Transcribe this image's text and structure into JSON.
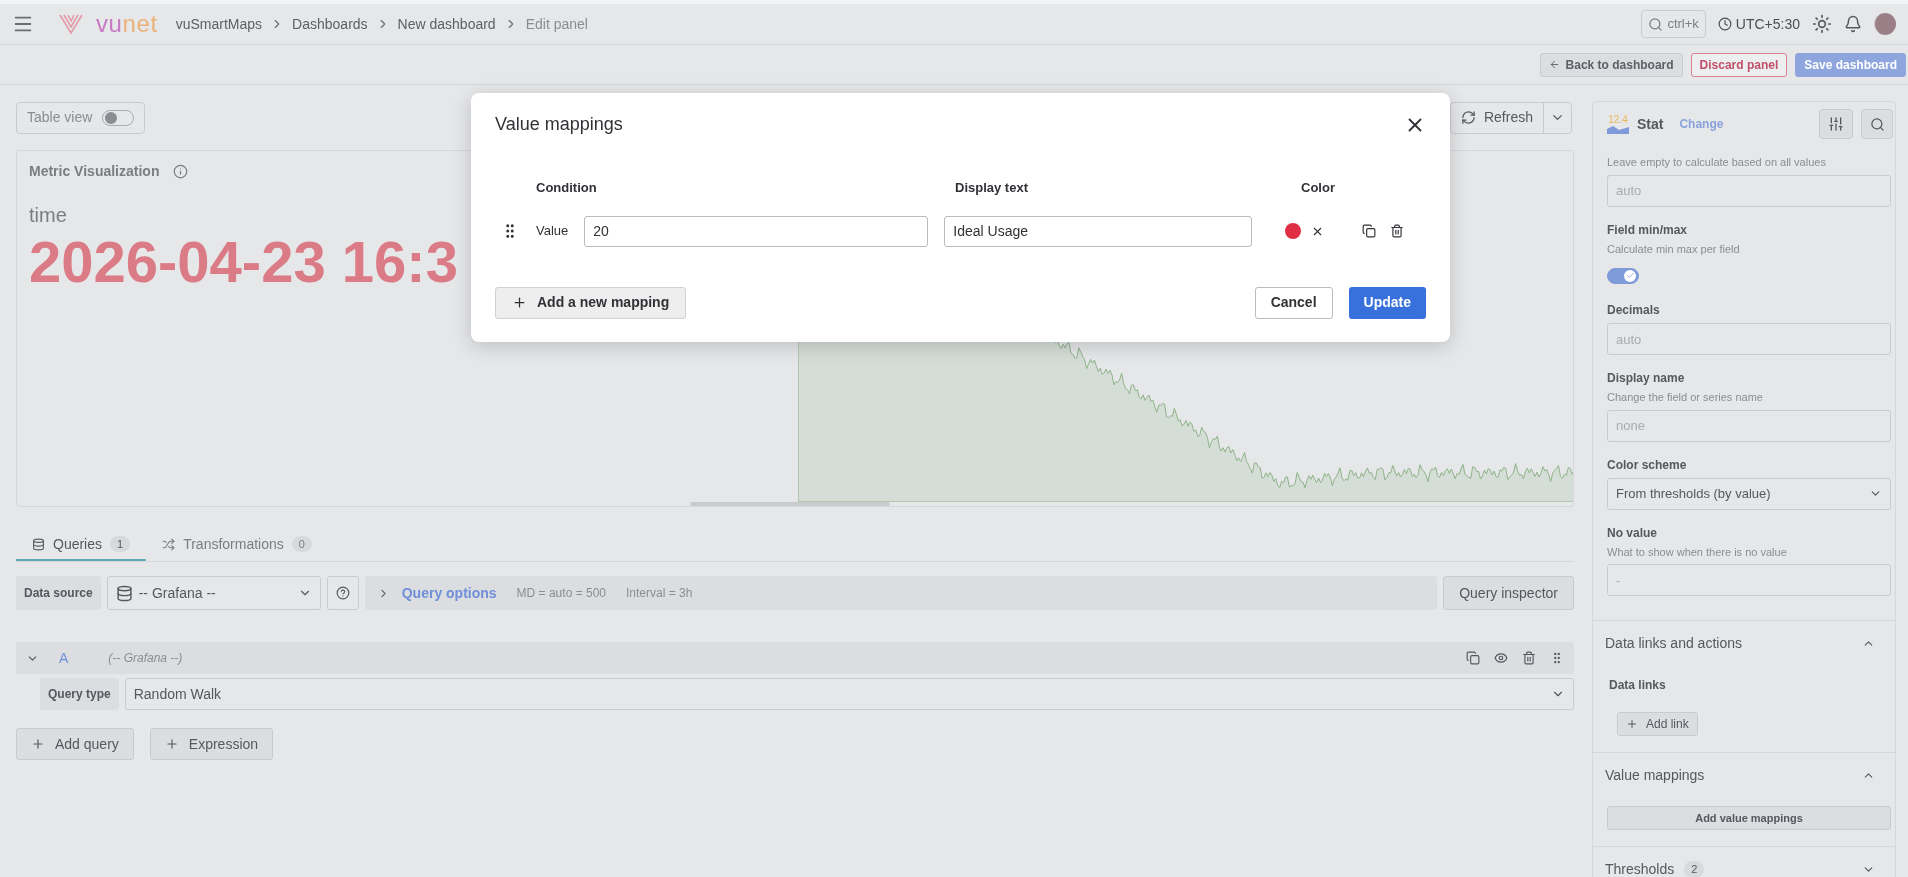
{
  "top_bar": {
    "logo": {
      "part_1": "vu",
      "part_2": "net"
    },
    "breadcrumbs": [
      "vuSmartMaps",
      "Dashboards",
      "New dashboard",
      "Edit panel"
    ],
    "search_shortcut": "ctrl+k",
    "timezone": "UTC+5:30"
  },
  "toolbar": {
    "buttons": [
      {
        "label": "Back to dashboard",
        "kind": "back"
      },
      {
        "label": "Discard panel",
        "kind": "danger"
      },
      {
        "label": "Save dashboard",
        "kind": "primary"
      }
    ]
  },
  "preview": {
    "table_view": {
      "label": "Table view",
      "on": false
    },
    "refresh": "Refresh",
    "panel": {
      "title": "Metric Visualization",
      "field": "time",
      "value": "2026-04-23 16:3"
    }
  },
  "query_tabs": [
    {
      "label": "Queries",
      "count": "1",
      "selected": true
    },
    {
      "label": "Transformations",
      "count": "0",
      "selected": false
    }
  ],
  "data_source": {
    "label": "Data source",
    "value": "-- Grafana --",
    "query_options": "Query options",
    "md": "MD = auto = 500",
    "interval": "Interval = 3h",
    "inspector": "Query inspector"
  },
  "query": {
    "ref": "A",
    "source": "(-- Grafana --)",
    "expanded": true,
    "query_type_label": "Query type",
    "query_type": "Random Walk"
  },
  "query_buttons": [
    "Add query",
    "Expression"
  ],
  "sidebar": {
    "viz_badge": "12.4",
    "viz_name": "Stat",
    "change": "Change",
    "fields": [
      {
        "kind": "input",
        "description": "Leave empty to calculate based on all values",
        "placeholder": "auto"
      },
      {
        "kind": "toggle",
        "label": "Field min/max",
        "description": "Calculate min max per field",
        "on": true
      },
      {
        "kind": "input",
        "label": "Decimals",
        "placeholder": "auto"
      },
      {
        "kind": "input",
        "label": "Display name",
        "description": "Change the field or series name",
        "placeholder": "none"
      },
      {
        "kind": "select",
        "label": "Color scheme",
        "value": "From thresholds (by value)"
      },
      {
        "kind": "input",
        "label": "No value",
        "description": "What to show when there is no value",
        "placeholder": "-"
      }
    ],
    "sections": [
      {
        "title": "Data links and actions",
        "expanded": true,
        "kind": "links",
        "subtitle": "Data links",
        "button": "Add link"
      },
      {
        "title": "Value mappings",
        "expanded": true,
        "kind": "wide",
        "button": "Add value mappings"
      },
      {
        "title": "Thresholds",
        "count": "2",
        "expanded": false,
        "kind": "collapsed"
      }
    ]
  },
  "modal": {
    "title": "Value mappings",
    "columns": [
      "Condition",
      "Display text",
      "Color"
    ],
    "mappings": [
      {
        "type": "Value",
        "condition": "20",
        "display_text": "Ideal Usage",
        "color": "#e02f44"
      }
    ],
    "add": "Add a new mapping",
    "cancel": "Cancel",
    "update": "Update"
  }
}
